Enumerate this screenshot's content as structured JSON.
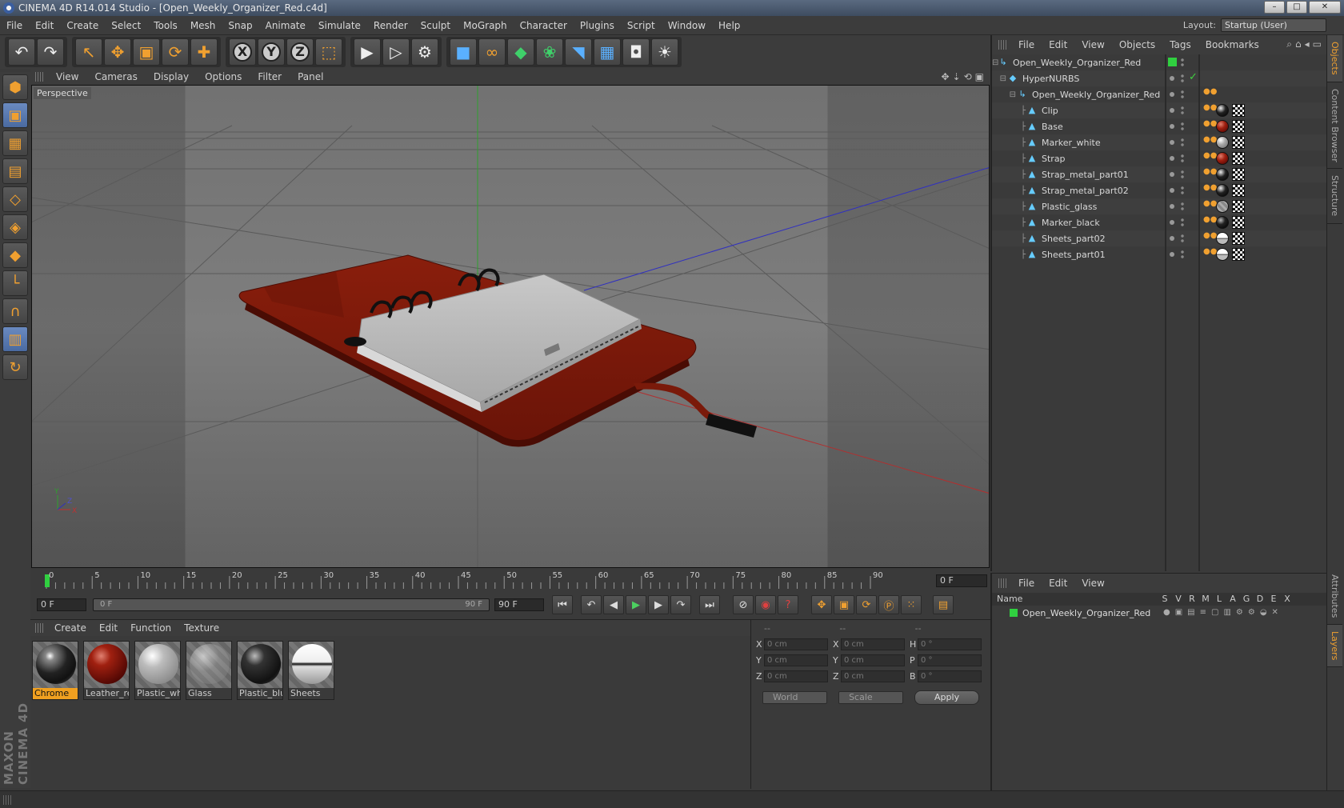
{
  "window": {
    "title": "CINEMA 4D R14.014 Studio - [Open_Weekly_Organizer_Red.c4d]",
    "buttons": [
      "–",
      "□",
      "✕"
    ]
  },
  "menubar": {
    "items": [
      "File",
      "Edit",
      "Create",
      "Select",
      "Tools",
      "Mesh",
      "Snap",
      "Animate",
      "Simulate",
      "Render",
      "Sculpt",
      "MoGraph",
      "Character",
      "Plugins",
      "Script",
      "Window",
      "Help"
    ],
    "layout_label": "Layout:",
    "layout_value": "Startup (User)"
  },
  "toolbar": {
    "groups": [
      [
        {
          "name": "undo-icon",
          "glyph": "↶",
          "tone": "white"
        },
        {
          "name": "redo-icon",
          "glyph": "↷",
          "tone": "white"
        }
      ],
      [
        {
          "name": "live-selection-icon",
          "glyph": "↖",
          "tone": ""
        },
        {
          "name": "move-icon",
          "glyph": "✥",
          "tone": ""
        },
        {
          "name": "scale-icon",
          "glyph": "▣",
          "tone": ""
        },
        {
          "name": "rotate-icon",
          "glyph": "⟳",
          "tone": ""
        },
        {
          "name": "recent-tool-icon",
          "glyph": "✚",
          "tone": ""
        }
      ],
      [
        {
          "name": "x-axis-lock-icon",
          "glyph": "X",
          "tone": "axis"
        },
        {
          "name": "y-axis-lock-icon",
          "glyph": "Y",
          "tone": "axis"
        },
        {
          "name": "z-axis-lock-icon",
          "glyph": "Z",
          "tone": "axis"
        },
        {
          "name": "coordinate-system-icon",
          "glyph": "⬚",
          "tone": ""
        }
      ],
      [
        {
          "name": "render-view-icon",
          "glyph": "▶",
          "tone": "white"
        },
        {
          "name": "render-picture-viewer-icon",
          "glyph": "▷",
          "tone": "white"
        },
        {
          "name": "render-settings-icon",
          "glyph": "⚙",
          "tone": "white"
        }
      ],
      [
        {
          "name": "cube-primitive-icon",
          "glyph": "■",
          "tone": "blue"
        },
        {
          "name": "spline-icon",
          "glyph": "∞",
          "tone": ""
        },
        {
          "name": "hypernurbs-icon",
          "glyph": "◆",
          "tone": "green"
        },
        {
          "name": "cloner-icon",
          "glyph": "❀",
          "tone": "green"
        },
        {
          "name": "deformer-icon",
          "glyph": "◥",
          "tone": "blue"
        },
        {
          "name": "floor-icon",
          "glyph": "▦",
          "tone": "blue"
        },
        {
          "name": "camera-icon",
          "glyph": "◘",
          "tone": "white"
        },
        {
          "name": "light-icon",
          "glyph": "☀",
          "tone": "white"
        }
      ]
    ]
  },
  "lefttools": [
    {
      "name": "make-editable-icon",
      "glyph": "⬢",
      "active": false
    },
    {
      "name": "model-mode-icon",
      "glyph": "▣",
      "active": true
    },
    {
      "name": "texture-mode-icon",
      "glyph": "▦",
      "active": false
    },
    {
      "name": "workplane-mode-icon",
      "glyph": "▤",
      "active": false
    },
    {
      "name": "points-mode-icon",
      "glyph": "◇",
      "active": false
    },
    {
      "name": "edges-mode-icon",
      "glyph": "◈",
      "active": false
    },
    {
      "name": "polygons-mode-icon",
      "glyph": "◆",
      "active": false
    },
    {
      "name": "axis-mode-icon",
      "glyph": "└",
      "active": false
    },
    {
      "name": "snap-icon",
      "glyph": "∩",
      "active": false
    },
    {
      "name": "workplane-icon",
      "glyph": "▥",
      "active": true
    },
    {
      "name": "locked-workplane-icon",
      "glyph": "↻",
      "active": false
    }
  ],
  "brand": "MAXON CINEMA 4D",
  "viewport": {
    "menu": [
      "View",
      "Cameras",
      "Display",
      "Options",
      "Filter",
      "Panel"
    ],
    "label": "Perspective"
  },
  "timeline": {
    "ticks": [
      "0",
      "5",
      "10",
      "15",
      "20",
      "25",
      "30",
      "35",
      "40",
      "45",
      "50",
      "55",
      "60",
      "65",
      "70",
      "75",
      "80",
      "85",
      "90"
    ],
    "current_frame": "0 F"
  },
  "playback": {
    "start": "0 F",
    "range_start": "0 F",
    "range_end": "90 F",
    "end": "90 F"
  },
  "materials": {
    "menu": [
      "Create",
      "Edit",
      "Function",
      "Texture"
    ],
    "items": [
      {
        "label": "Chrome",
        "selected": true,
        "ball": "radial-gradient(circle at 35% 30%, #fff 0%, #888 12%, #222 45%, #111 70%, #555 100%)"
      },
      {
        "label": "Leather_red",
        "selected": false,
        "ball": "radial-gradient(circle at 35% 30%, #e08070 0%, #a02010 25%, #5a0a05 70%, #300 100%)"
      },
      {
        "label": "Plastic_white",
        "selected": false,
        "ball": "radial-gradient(circle at 35% 30%, #fff 0%, #bbb 30%, #888 80%, #666 100%)"
      },
      {
        "label": "Glass",
        "selected": false,
        "ball": "radial-gradient(circle at 35% 30%, rgba(255,255,255,0.6) 0%, rgba(200,200,200,0.25) 40%, rgba(120,120,120,0.35) 100%)"
      },
      {
        "label": "Plastic_blue",
        "selected": false,
        "ball": "radial-gradient(circle at 35% 30%, #bbb 0%, #333 25%, #111 70%, #444 100%)"
      },
      {
        "label": "Sheets",
        "selected": false,
        "ball": "linear-gradient(#fff 0%, #eee 45%, #111 50%, #ddd 56%, #999 100%)"
      }
    ]
  },
  "coords": {
    "headers": [
      "--",
      "--",
      "--"
    ],
    "rows": [
      {
        "a1": "X",
        "v1": "0 cm",
        "a2": "X",
        "v2": "0 cm",
        "a3": "H",
        "v3": "0 °"
      },
      {
        "a1": "Y",
        "v1": "0 cm",
        "a2": "Y",
        "v2": "0 cm",
        "a3": "P",
        "v3": "0 °"
      },
      {
        "a1": "Z",
        "v1": "0 cm",
        "a2": "Z",
        "v2": "0 cm",
        "a3": "B",
        "v3": "0 °"
      }
    ],
    "mode_world": "World",
    "mode_scale": "Scale",
    "apply_label": "Apply"
  },
  "objects": {
    "menu": [
      "File",
      "Edit",
      "View",
      "Objects",
      "Tags",
      "Bookmarks"
    ],
    "rows": [
      {
        "name": "Open_Weekly_Organizer_Red",
        "indent": 0,
        "icon": "↳",
        "mat": "",
        "greenbox": true
      },
      {
        "name": "HyperNURBS",
        "indent": 1,
        "icon": "◆",
        "mat": "",
        "check": true
      },
      {
        "name": "Open_Weekly_Organizer_Red",
        "indent": 2,
        "icon": "↳",
        "mat": "",
        "tag": true
      },
      {
        "name": "Clip",
        "indent": 3,
        "icon": "▲",
        "mat": "radial-gradient(circle at 35% 30%, #eee, #222 45%, #000)"
      },
      {
        "name": "Base",
        "indent": 3,
        "icon": "▲",
        "mat": "radial-gradient(circle at 35% 30%, #e08070, #a02010 40%, #400)"
      },
      {
        "name": "Marker_white",
        "indent": 3,
        "icon": "▲",
        "mat": "radial-gradient(circle at 35% 30%, #fff, #aaa 40%, #666)"
      },
      {
        "name": "Strap",
        "indent": 3,
        "icon": "▲",
        "mat": "radial-gradient(circle at 35% 30%, #e08070, #a02010 40%, #400)"
      },
      {
        "name": "Strap_metal_part01",
        "indent": 3,
        "icon": "▲",
        "mat": "radial-gradient(circle at 35% 30%, #eee, #222 45%, #000)"
      },
      {
        "name": "Strap_metal_part02",
        "indent": 3,
        "icon": "▲",
        "mat": "radial-gradient(circle at 35% 30%, #eee, #222 45%, #000)"
      },
      {
        "name": "Plastic_glass",
        "indent": 3,
        "icon": "▲",
        "mat": "repeating-linear-gradient(45deg,#888 0 3px,#aaa 3px 6px)"
      },
      {
        "name": "Marker_black",
        "indent": 3,
        "icon": "▲",
        "mat": "radial-gradient(circle at 35% 30%, #bbb, #222 40%, #000)"
      },
      {
        "name": "Sheets_part02",
        "indent": 3,
        "icon": "▲",
        "mat": "linear-gradient(#fff 45%, #111 50%, #bbb 56%)"
      },
      {
        "name": "Sheets_part01",
        "indent": 3,
        "icon": "▲",
        "mat": "linear-gradient(#fff 45%, #111 50%, #bbb 56%)"
      }
    ]
  },
  "right_tabs": [
    "Objects",
    "Content Browser",
    "Structure",
    "Attributes",
    "Layers"
  ],
  "layers": {
    "menu": [
      "File",
      "Edit",
      "View"
    ],
    "columns": [
      "Name",
      "S",
      "V",
      "R",
      "M",
      "L",
      "A",
      "G",
      "D",
      "E",
      "X"
    ],
    "row_name": "Open_Weekly_Organizer_Red"
  }
}
